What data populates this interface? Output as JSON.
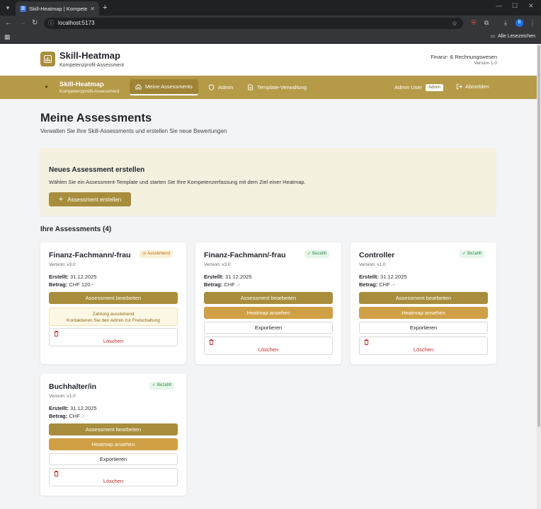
{
  "browser": {
    "tab_title": "Skill-Heatmap | Kompetenzpr...",
    "url": "localhost:5173",
    "bookmarks_label": "Alle Lesezeichen",
    "profile_initial": "B"
  },
  "header": {
    "title": "Skill-Heatmap",
    "subtitle": "Kompetenzprofil-Assessment",
    "org": "Finanz- & Rechnungswesen",
    "version": "Version 1.0"
  },
  "nav": {
    "brand": "Skill-Heatmap",
    "brand_sub": "Kompetenzprofil-Assessment",
    "items": [
      {
        "label": "Meine Assessments",
        "icon": "home-icon"
      },
      {
        "label": "Admin",
        "icon": "shield-icon"
      },
      {
        "label": "Template-Verwaltung",
        "icon": "document-icon"
      }
    ],
    "user": "Admin User",
    "role_badge": "Admin",
    "logout": "Abmelden"
  },
  "page": {
    "title": "Meine Assessments",
    "description": "Verwalten Sie Ihre Skill-Assessments und erstellen Sie neue Bewertungen"
  },
  "create": {
    "title": "Neues Assessment erstellen",
    "description": "Wählen Sie ein Assessment-Template und starten Sie Ihre Kompetenzerfassung mit dem Ziel einer Heatmap.",
    "button": "Assessment erstellen"
  },
  "section_title": "Ihre Assessments (4)",
  "labels": {
    "created": "Erstellt:",
    "amount": "Betrag:",
    "edit": "Assessment bearbeiten",
    "heatmap": "Heatmap ansehen",
    "export": "Exportieren",
    "delete": "Löschen"
  },
  "cards": [
    {
      "title": "Finanz-Fachmann/-frau",
      "version": "Version: v3.0",
      "status": "Ausstehend",
      "created": "31.12.2025",
      "amount": "CHF 120.-",
      "notice_line1": "Zahlung ausstehend",
      "notice_line2": "Kontaktieren Sie den Admin zur Freischaltung"
    },
    {
      "title": "Finanz-Fachmann/-frau",
      "version": "Version: v3.0",
      "status": "Bezahlt",
      "created": "31.12.2025",
      "amount": "CHF .-"
    },
    {
      "title": "Controller",
      "version": "Version: v1.0",
      "status": "Bezahlt",
      "created": "31.12.2025",
      "amount": "CHF .-"
    },
    {
      "title": "Buchhalter/in",
      "version": "Version: v1.0",
      "status": "Bezahlt",
      "created": "31.12.2025",
      "amount": "CHF .-"
    }
  ],
  "colors": {
    "brand": "#a88d3c",
    "nav": "#b59a48",
    "heatmap_button": "#cfa045",
    "paid": "#2e8b47",
    "pending": "#b0720f",
    "danger": "#c62828"
  }
}
